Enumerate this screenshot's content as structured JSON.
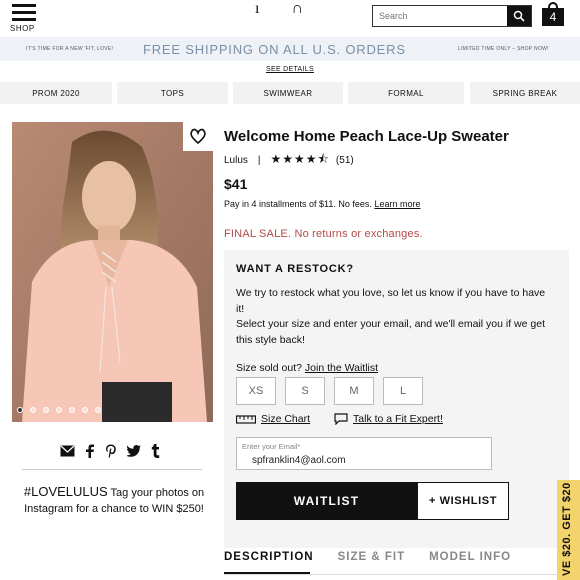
{
  "header": {
    "shop_label": "SHOP",
    "logo_text": "ı ∩",
    "search_placeholder": "Search",
    "bag_count": "4"
  },
  "promo": {
    "left_text": "IT'S TIME FOR A NEW 'FIT, LOVE!",
    "main_text": "FREE SHIPPING ON ALL U.S. ORDERS",
    "right_text": "LIMITED TIME ONLY – SHOP NOW!",
    "see_details": "SEE DETAILS",
    "color": "#7a8fa8"
  },
  "categories": [
    "PROM 2020",
    "TOPS",
    "SWIMWEAR",
    "FORMAL",
    "SPRING BREAK"
  ],
  "product": {
    "title": "Welcome Home Peach Lace-Up Sweater",
    "brand": "Lulus",
    "separator": "|",
    "stars": "★★★★⯪",
    "rating": 4.5,
    "review_count": "(51)",
    "price": "$41",
    "installments_text": "Pay in 4 installments of  $11. No fees.",
    "learn_more": "Learn more",
    "final_sale": "FINAL SALE. No returns or exchanges."
  },
  "gallery": {
    "dot_count": 7,
    "active_dot": 0
  },
  "social_icons": [
    "email-icon",
    "facebook-icon",
    "pinterest-icon",
    "twitter-icon",
    "tumblr-icon"
  ],
  "lovelulus": {
    "hashtag": "#LOVELULUS",
    "text": " Tag your photos on Instagram for a chance to WIN $250!"
  },
  "restock": {
    "title": "WANT A RESTOCK?",
    "line1": "We try to restock what you love, so let us know if you have to have it!",
    "line2": "Select your size and enter your email, and we'll email you if we get this style back!",
    "sold_out": "Size sold out?",
    "join_waitlist": "Join the Waitlist",
    "sizes": [
      "XS",
      "S",
      "M",
      "L"
    ],
    "size_chart": "Size Chart",
    "fit_expert": "Talk to a Fit Expert!",
    "email_label": "Enter your Email*",
    "email_value": "spfranklin4@aol.com",
    "waitlist_button": "WAITLIST",
    "wishlist_button": "+ WISHLIST"
  },
  "tabs": [
    "DESCRIPTION",
    "SIZE & FIT",
    "MODEL INFO"
  ],
  "side_promo": "VE $20. GET $20"
}
